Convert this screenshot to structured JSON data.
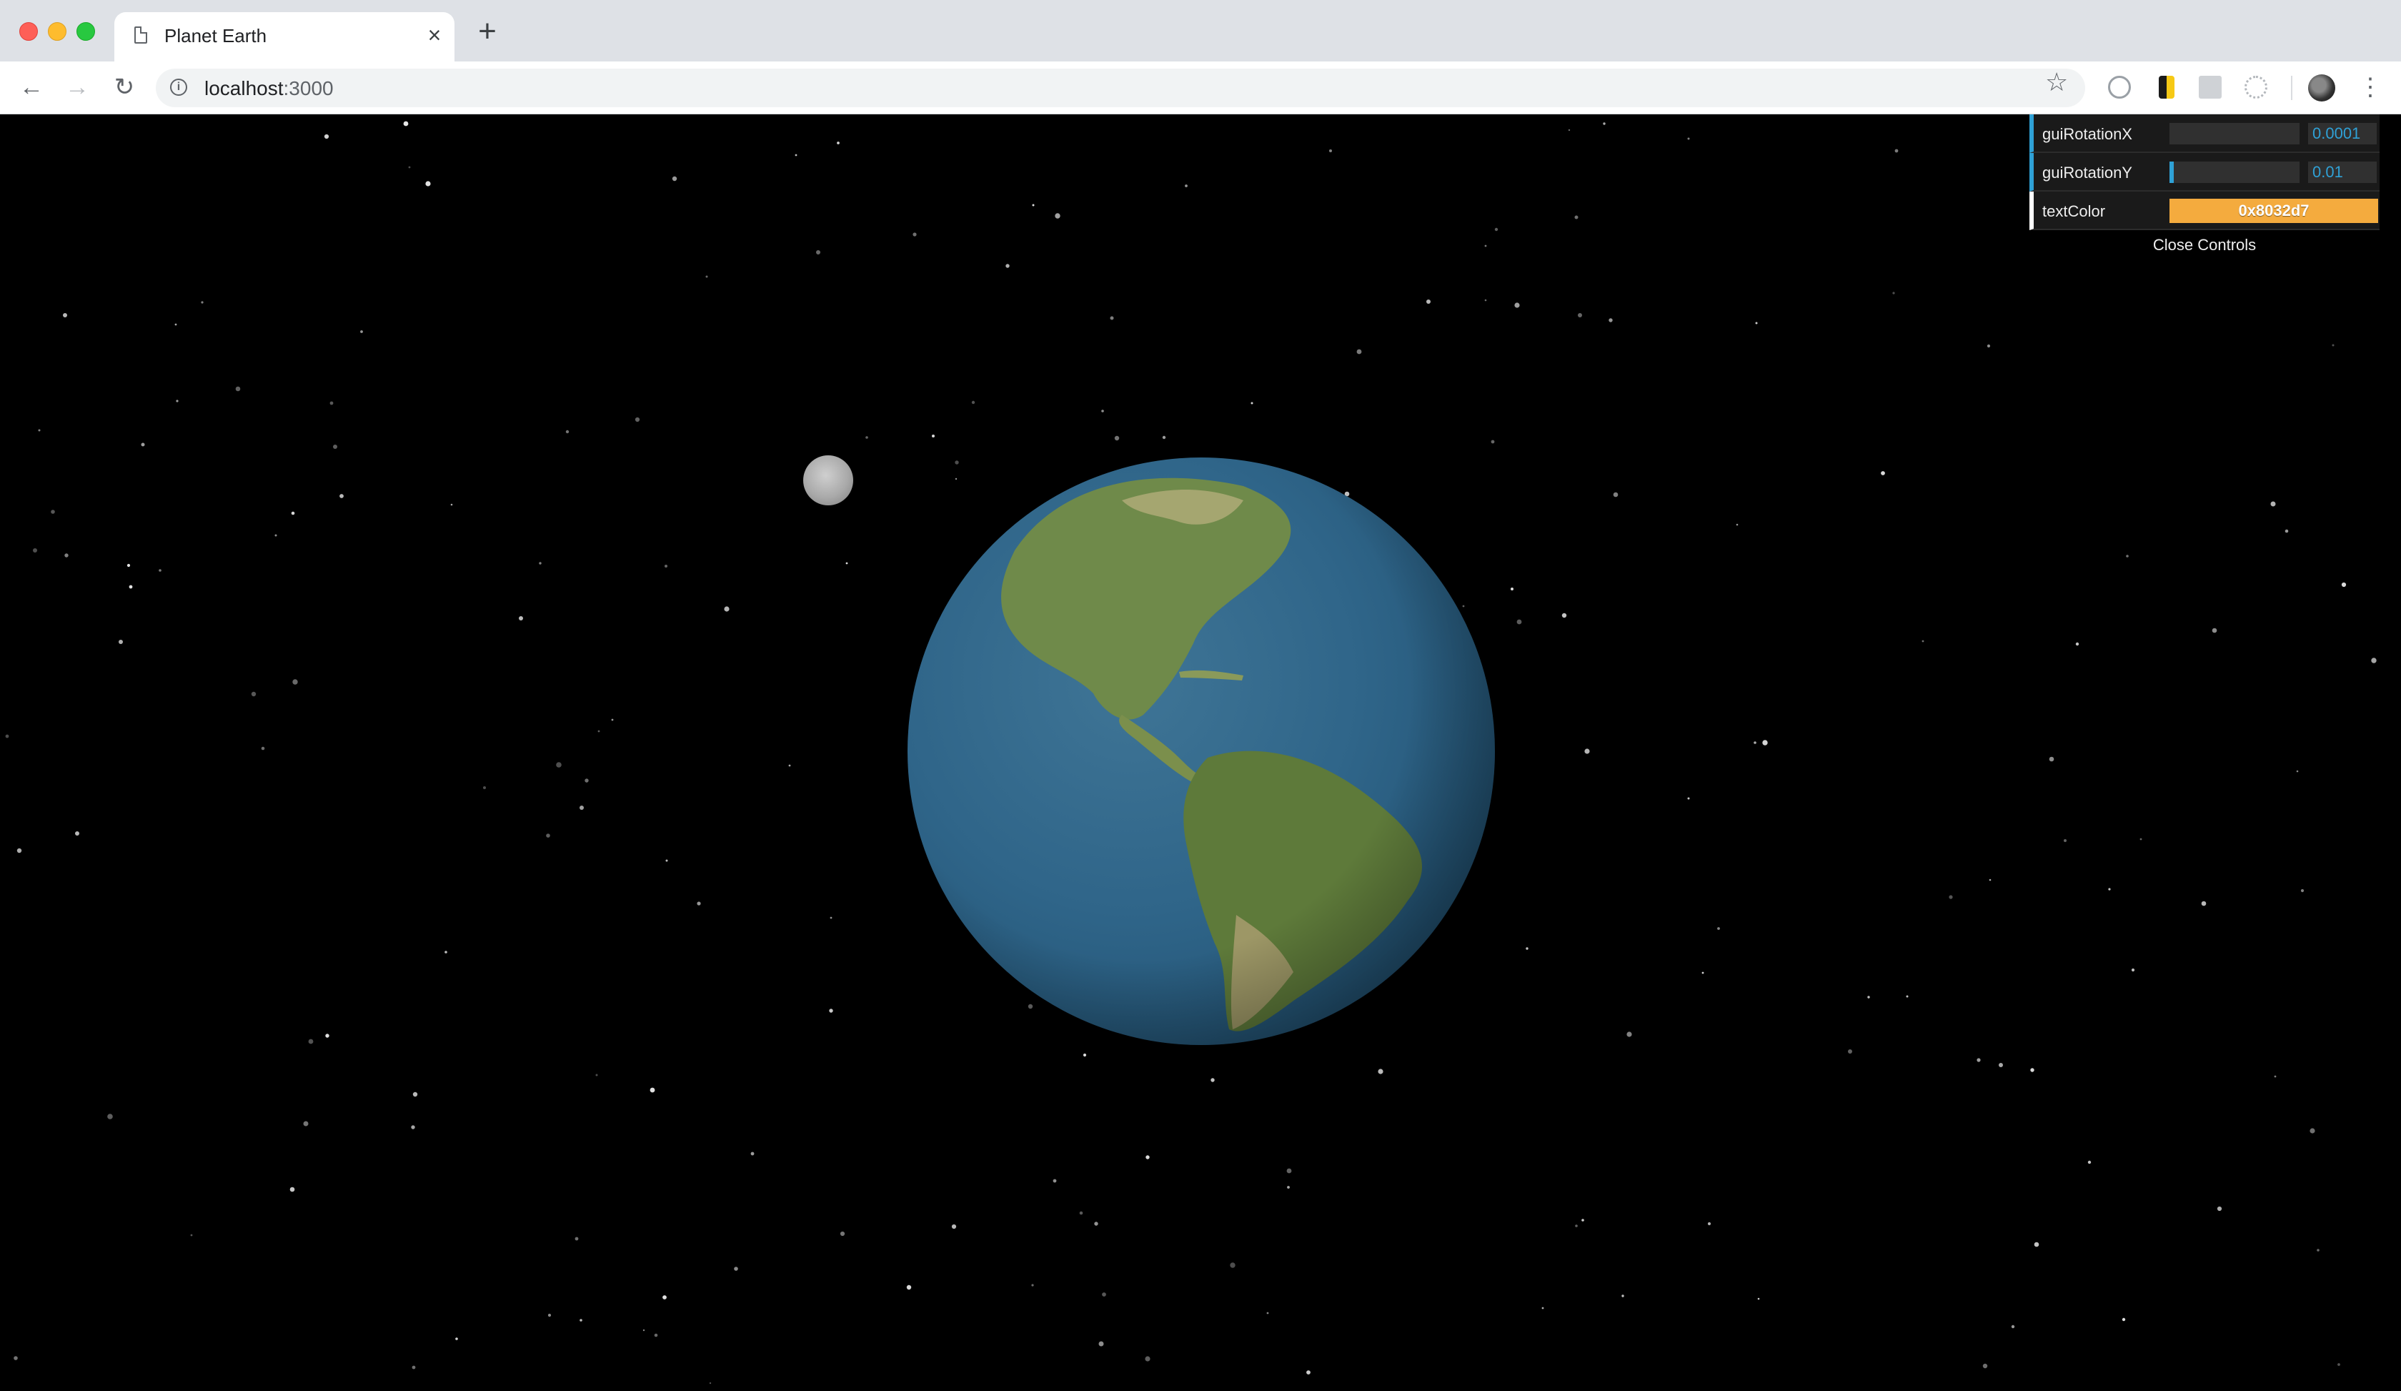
{
  "browser": {
    "tab_title": "Planet Earth",
    "tab_close_glyph": "×",
    "new_tab_glyph": "+",
    "url_host": "localhost",
    "url_port": ":3000",
    "icons": [
      "back-arrow-icon",
      "forward-arrow-icon",
      "reload-icon",
      "info-icon",
      "star-icon",
      "menu-icon"
    ]
  },
  "gui": {
    "controls": [
      {
        "label": "guiRotationX",
        "value": "0.0001",
        "fill_fraction": 0.0
      },
      {
        "label": "guiRotationY",
        "value": "0.01",
        "fill_fraction": 0.03
      }
    ],
    "color_control": {
      "label": "textColor",
      "value": "0x8032d7",
      "swatch": "#f4ab3e"
    },
    "close_label": "Close Controls",
    "accent": "#2fa1d6"
  }
}
